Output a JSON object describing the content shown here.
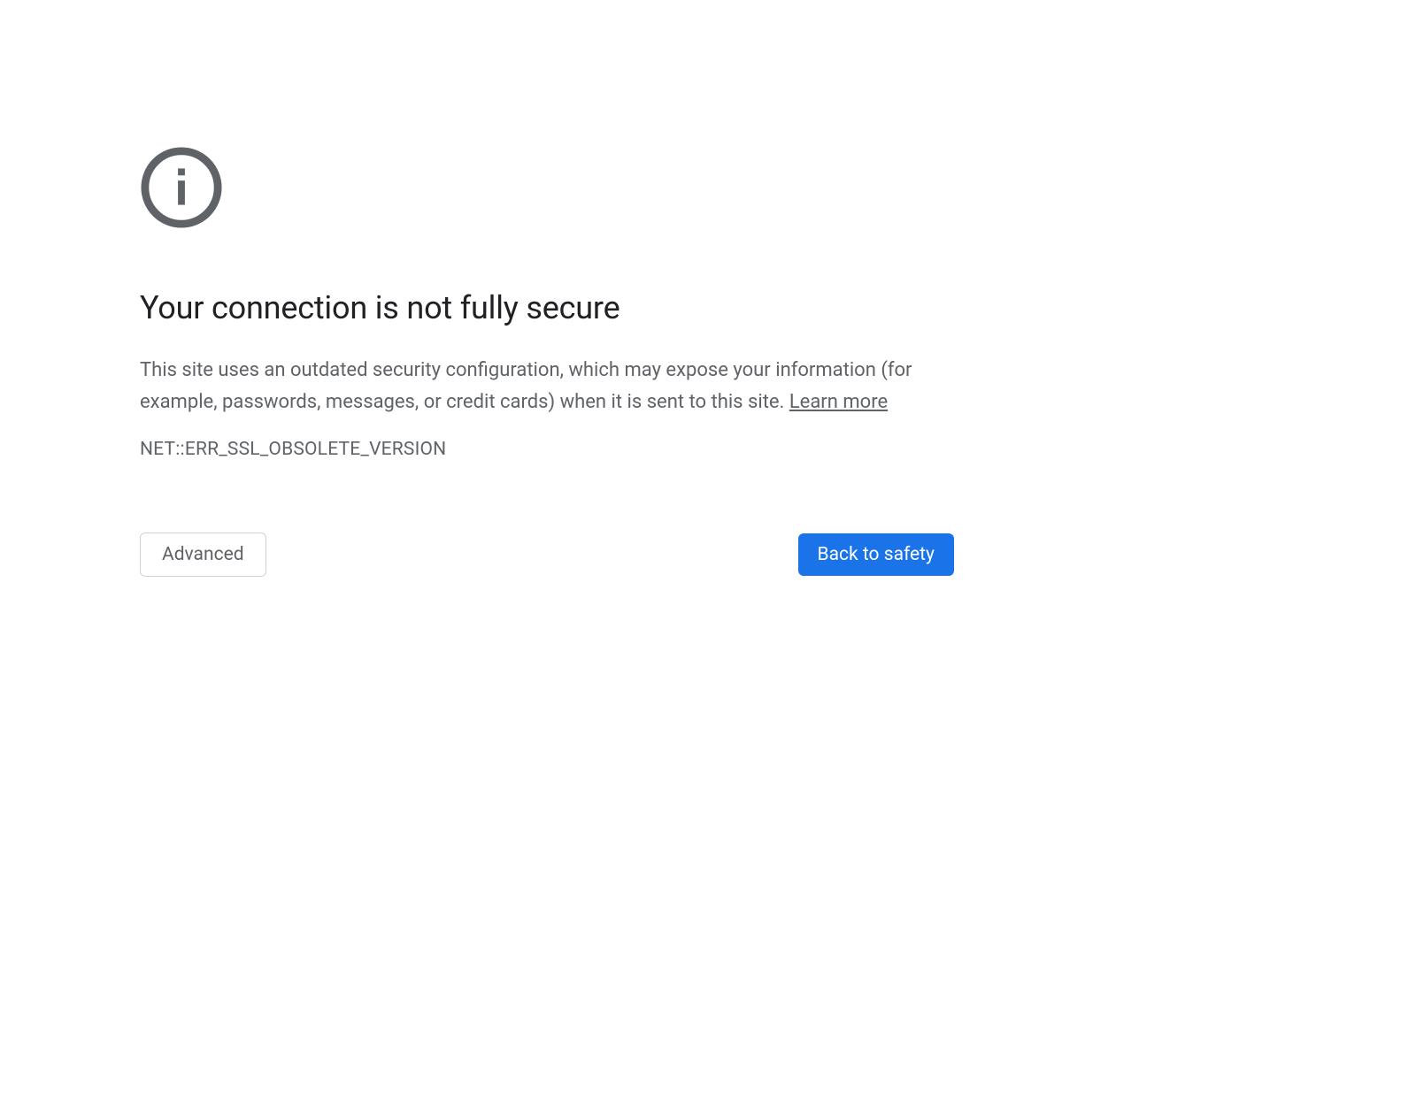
{
  "interstitial": {
    "title": "Your connection is not fully secure",
    "description_text": "This site uses an outdated security configuration, which may expose your information (for example, passwords, messages, or credit cards) when it is sent to this site. ",
    "learn_more_label": "Learn more",
    "error_code": "NET::ERR_SSL_OBSOLETE_VERSION",
    "buttons": {
      "advanced": "Advanced",
      "back_to_safety": "Back to safety"
    },
    "colors": {
      "accent": "#1a73e8",
      "text_primary": "#202124",
      "text_secondary": "#5f6368",
      "border": "#d0d3d6"
    },
    "icon": "info-icon"
  }
}
